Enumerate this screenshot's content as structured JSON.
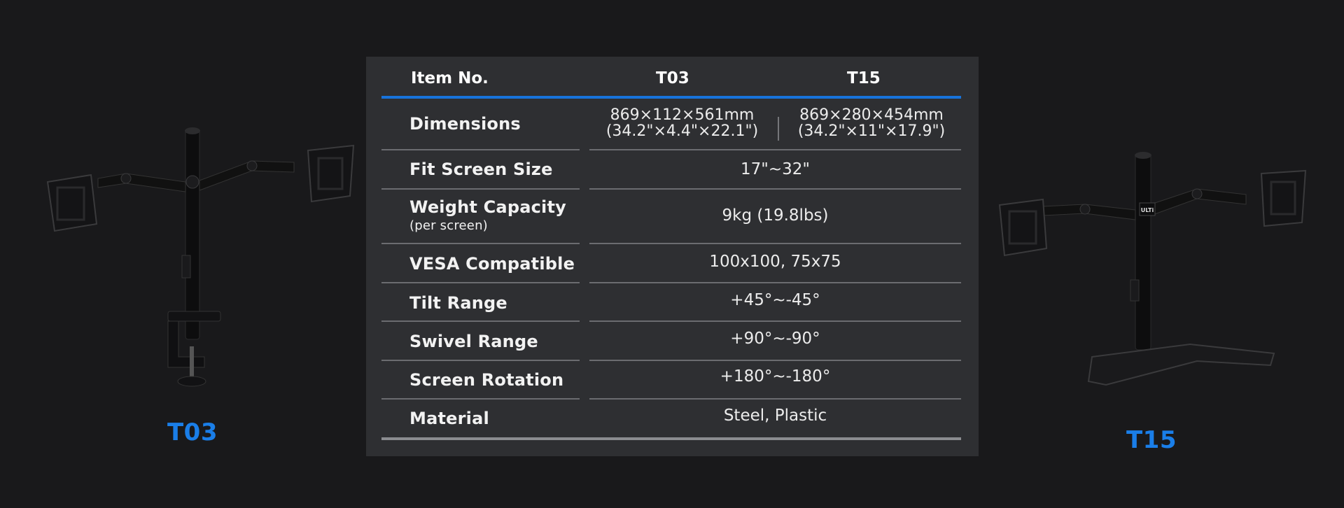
{
  "products": {
    "left": {
      "name": "T03"
    },
    "right": {
      "name": "T15",
      "logo_text": "ULTi"
    }
  },
  "table": {
    "header": {
      "item_no": "Item No.",
      "col1": "T03",
      "col2": "T15"
    },
    "rows": [
      {
        "label": "Dimensions",
        "t03_line1": "869×112×561mm",
        "t03_line2": "(34.2\"×4.4\"×22.1\")",
        "t15_line1": "869×280×454mm",
        "t15_line2": "(34.2\"×11\"×17.9\")"
      },
      {
        "label": "Fit Screen Size",
        "value": "17\"~32\""
      },
      {
        "label": "Weight Capacity",
        "sublabel": "(per screen)",
        "value": "9kg (19.8lbs)"
      },
      {
        "label": "VESA Compatible",
        "value": "100x100, 75x75"
      },
      {
        "label": "Tilt Range",
        "value": "+45°~-45°"
      },
      {
        "label": "Swivel Range",
        "value": "+90°~-90°"
      },
      {
        "label": "Screen Rotation",
        "value": "+180°~-180°"
      },
      {
        "label": "Material",
        "value": "Steel, Plastic"
      }
    ]
  },
  "colors": {
    "background": "#19191b",
    "panel": "#2e2f32",
    "accent": "#1773db",
    "label_blue": "#1a7ee8"
  }
}
